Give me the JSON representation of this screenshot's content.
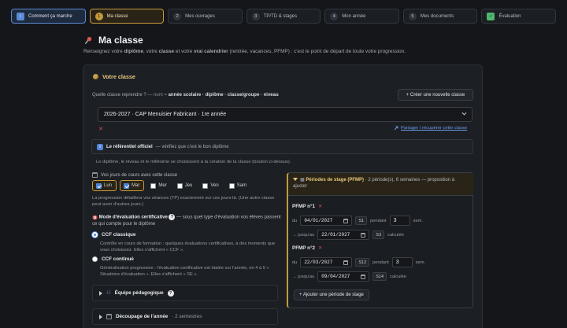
{
  "stepper": [
    {
      "num": "",
      "label": "Comment ça marche"
    },
    {
      "num": "1",
      "label": "Ma classe"
    },
    {
      "num": "2",
      "label": "Mes ouvrages"
    },
    {
      "num": "3",
      "label": "TP/TD & stages"
    },
    {
      "num": "4",
      "label": "Mon année"
    },
    {
      "num": "5",
      "label": "Mes documents"
    },
    {
      "num": "",
      "label": "Évaluation"
    }
  ],
  "header": {
    "title": "Ma classe",
    "subtitle_1": "Renseignez votre ",
    "subtitle_b1": "diplôme",
    "subtitle_2": ", votre ",
    "subtitle_b2": "classe",
    "subtitle_3": " et votre ",
    "subtitle_b3": "vrai calendrier",
    "subtitle_4": " (rentrée, vacances, PFMP) : c'est le point de départ de toute votre progression."
  },
  "votre_classe": {
    "title": "Votre classe",
    "reprendre_label": "Quelle classe reprendre ?",
    "reprendre_eq": "— nom = ",
    "reprendre_format": "année scolaire · diplôme · classe/groupe · niveau",
    "create_button": "+ Créer une nouvelle classe",
    "selected_class": "2026-2027 · CAP Menuisier Fabricant · 1re année",
    "delete_symbol": "✕",
    "share_link": "Partager / récupérer cette classe",
    "referentiel_badge": "i",
    "referentiel_title": "Le référentiel officiel",
    "referentiel_text": " — vérifiez que c'est le bon diplôme",
    "referentiel_note": "Le diplôme, le niveau et le millésime se choisissent à la création de la classe (bouton ci-dessus)."
  },
  "days": {
    "label": "Vos jours de cours avec cette classe",
    "items": [
      {
        "label": "Lun",
        "checked": true
      },
      {
        "label": "Mar",
        "checked": true
      },
      {
        "label": "Mer",
        "checked": false
      },
      {
        "label": "Jeu",
        "checked": false
      },
      {
        "label": "Ven",
        "checked": false
      },
      {
        "label": "Sam",
        "checked": false
      }
    ],
    "note": "La progression détaillera vos séances (TP) exactement sur ces jours-là. (Une autre classe peut avoir d'autres jours.)"
  },
  "evaluation": {
    "label": "Mode d'évaluation certificative",
    "hint": " — sous quel type d'évaluation vos élèves passent ce qui compte pour le diplôme",
    "q_badge": "?",
    "options": [
      {
        "title": "CCF classique",
        "desc": "Contrôle en cours de formation : quelques évaluations certificatives, à des moments que vous choisissez. Elles s'affichent « CCF ».",
        "selected": true
      },
      {
        "title": "CCF continué",
        "desc": "Généralisation progressive : l'évaluation certificative est étalée sur l'année, en 4 à 5 « Situations d'évaluation ». Elles s'affichent « SE ».",
        "selected": false
      }
    ]
  },
  "sections": {
    "equipe": {
      "title": "Équipe pédagogique",
      "badge": "?"
    },
    "decoupage": {
      "title": "Découpage de l'année",
      "meta": "· 2 semestres"
    }
  },
  "stage": {
    "title": "Périodes de stage (PFMP)",
    "meta": " · 2 période(s), 6 semaines — proposition à ajuster",
    "periods": [
      {
        "title": "PFMP n°1",
        "du": "du",
        "start": "04/01/2027",
        "start_wk": "S1",
        "pendant": "pendant",
        "weeks": "3",
        "sem": "sem.",
        "jusqu": "→ jusqu'au",
        "end": "22/01/2027",
        "end_wk": "S3",
        "calc": "calculée"
      },
      {
        "title": "PFMP n°2",
        "du": "du",
        "start": "22/03/2027",
        "start_wk": "S12",
        "pendant": "pendant",
        "weeks": "3",
        "sem": "sem.",
        "jusqu": "→ jusqu'au",
        "end": "09/04/2027",
        "end_wk": "S14",
        "calc": "calculée"
      }
    ],
    "add_button": "+ Ajouter une période de stage"
  },
  "colors": {
    "accent_blue": "#5b8ad6",
    "accent_gold": "#c49a3a",
    "danger": "#d9534f",
    "link": "#6b9be8",
    "success": "#4fb66c"
  }
}
